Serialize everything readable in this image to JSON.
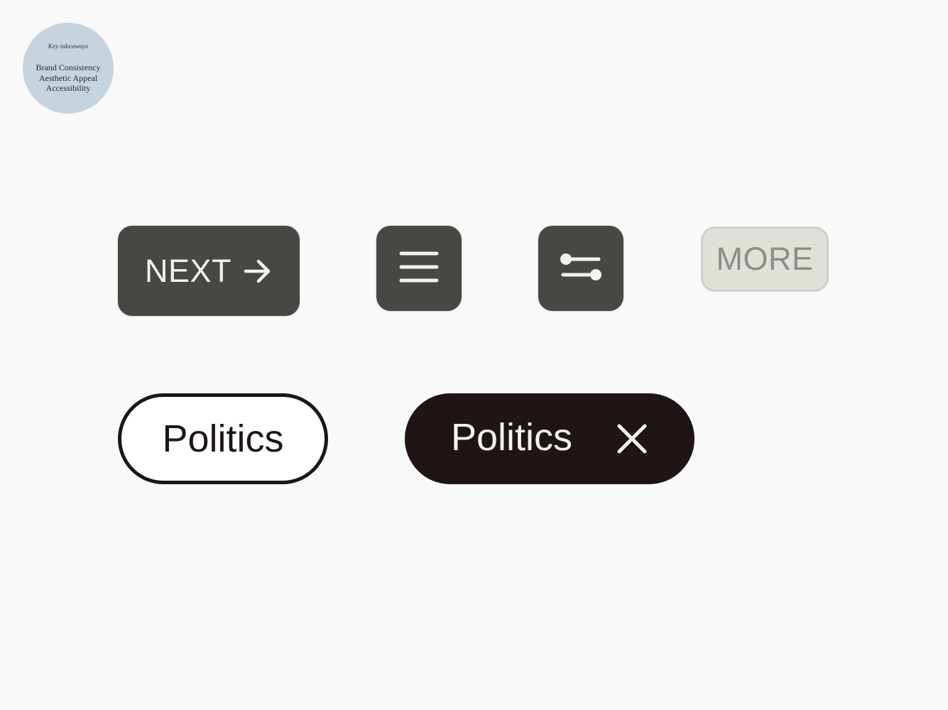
{
  "badge": {
    "title": "Key takeaways",
    "items": [
      "Brand Consistency",
      "Aesthetic Appeal",
      "Accessibility"
    ]
  },
  "buttons": {
    "next_label": "NEXT",
    "next_icon": "arrow-right-icon",
    "menu_icon": "hamburger-menu-icon",
    "filter_icon": "sliders-icon",
    "more_label": "MORE"
  },
  "chips": {
    "outline_label": "Politics",
    "filled_label": "Politics",
    "filled_icon": "close-icon"
  },
  "colors": {
    "background": "#f9f9f9",
    "badge": "#c5d4df",
    "button_dark": "#474843",
    "button_disabled": "#e0dfd8",
    "chip_dark": "#1e1515"
  }
}
